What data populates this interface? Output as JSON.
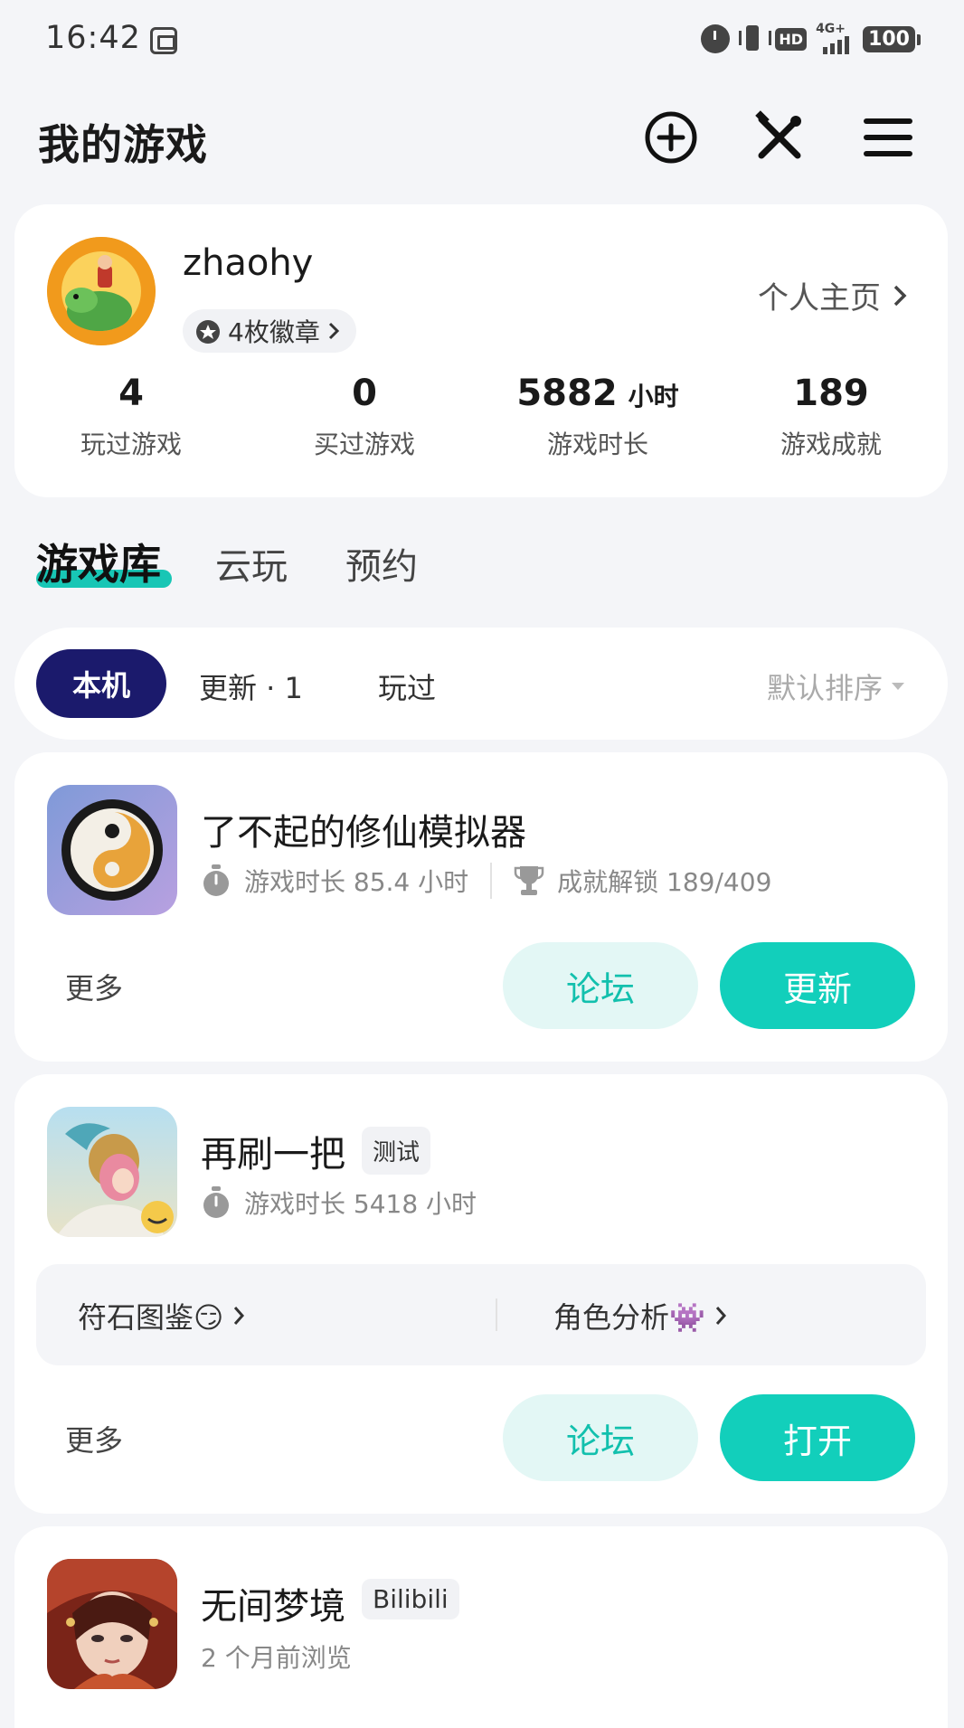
{
  "status_bar": {
    "time": "16:42",
    "battery": "100",
    "hd": "HD",
    "network": "4G+"
  },
  "header": {
    "title": "我的游戏",
    "icons": [
      "add-circle-icon",
      "tools-icon",
      "menu-icon"
    ]
  },
  "profile": {
    "username": "zhaohy",
    "badges_label": "4枚徽章",
    "homepage_label": "个人主页",
    "stats": [
      {
        "value": "4",
        "unit": "",
        "label": "玩过游戏"
      },
      {
        "value": "0",
        "unit": "",
        "label": "买过游戏"
      },
      {
        "value": "5882",
        "unit": "小时",
        "label": "游戏时长"
      },
      {
        "value": "189",
        "unit": "",
        "label": "游戏成就"
      }
    ]
  },
  "section_tabs": [
    "游戏库",
    "云玩",
    "预约"
  ],
  "filters": {
    "chips": [
      "本机",
      "更新 · 1",
      "玩过"
    ],
    "sort_label": "默认排序"
  },
  "games": [
    {
      "name": "了不起的修仙模拟器",
      "playtime": "游戏时长 85.4 小时",
      "achievements": "成就解锁 189/409",
      "more": "更多",
      "forum": "论坛",
      "action": "更新"
    },
    {
      "name": "再刷一把",
      "tag": "测试",
      "playtime": "游戏时长 5418 小时",
      "quick_links": [
        "符石图鉴😏",
        "角色分析👾"
      ],
      "more": "更多",
      "forum": "论坛",
      "action": "打开"
    },
    {
      "name": "无间梦境",
      "tag": "Bilibili",
      "subtitle": "2 个月前浏览"
    }
  ],
  "colors": {
    "accent": "#12cfbb",
    "accent_light": "#e3f7f5",
    "chip_active": "#1b1a6c",
    "background": "#f4f5f8"
  }
}
